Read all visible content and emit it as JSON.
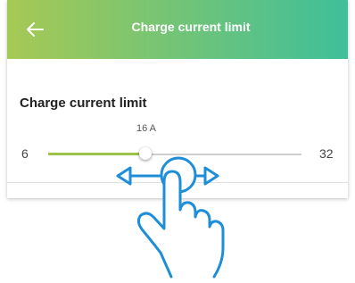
{
  "header": {
    "title": "Charge current limit",
    "back_icon": "arrow-left-icon"
  },
  "setting": {
    "title": "Charge current limit",
    "value_label": "16 A",
    "min_label": "6",
    "max_label": "32",
    "min": 6,
    "max": 32,
    "value": 16
  },
  "gesture": {
    "icon": "hand-swipe-horizontal-icon"
  },
  "colors": {
    "header_start": "#a6c954",
    "header_end": "#3fbf9a",
    "slider_fill": "#9bc24a",
    "gesture_stroke": "#1e8fd6"
  }
}
